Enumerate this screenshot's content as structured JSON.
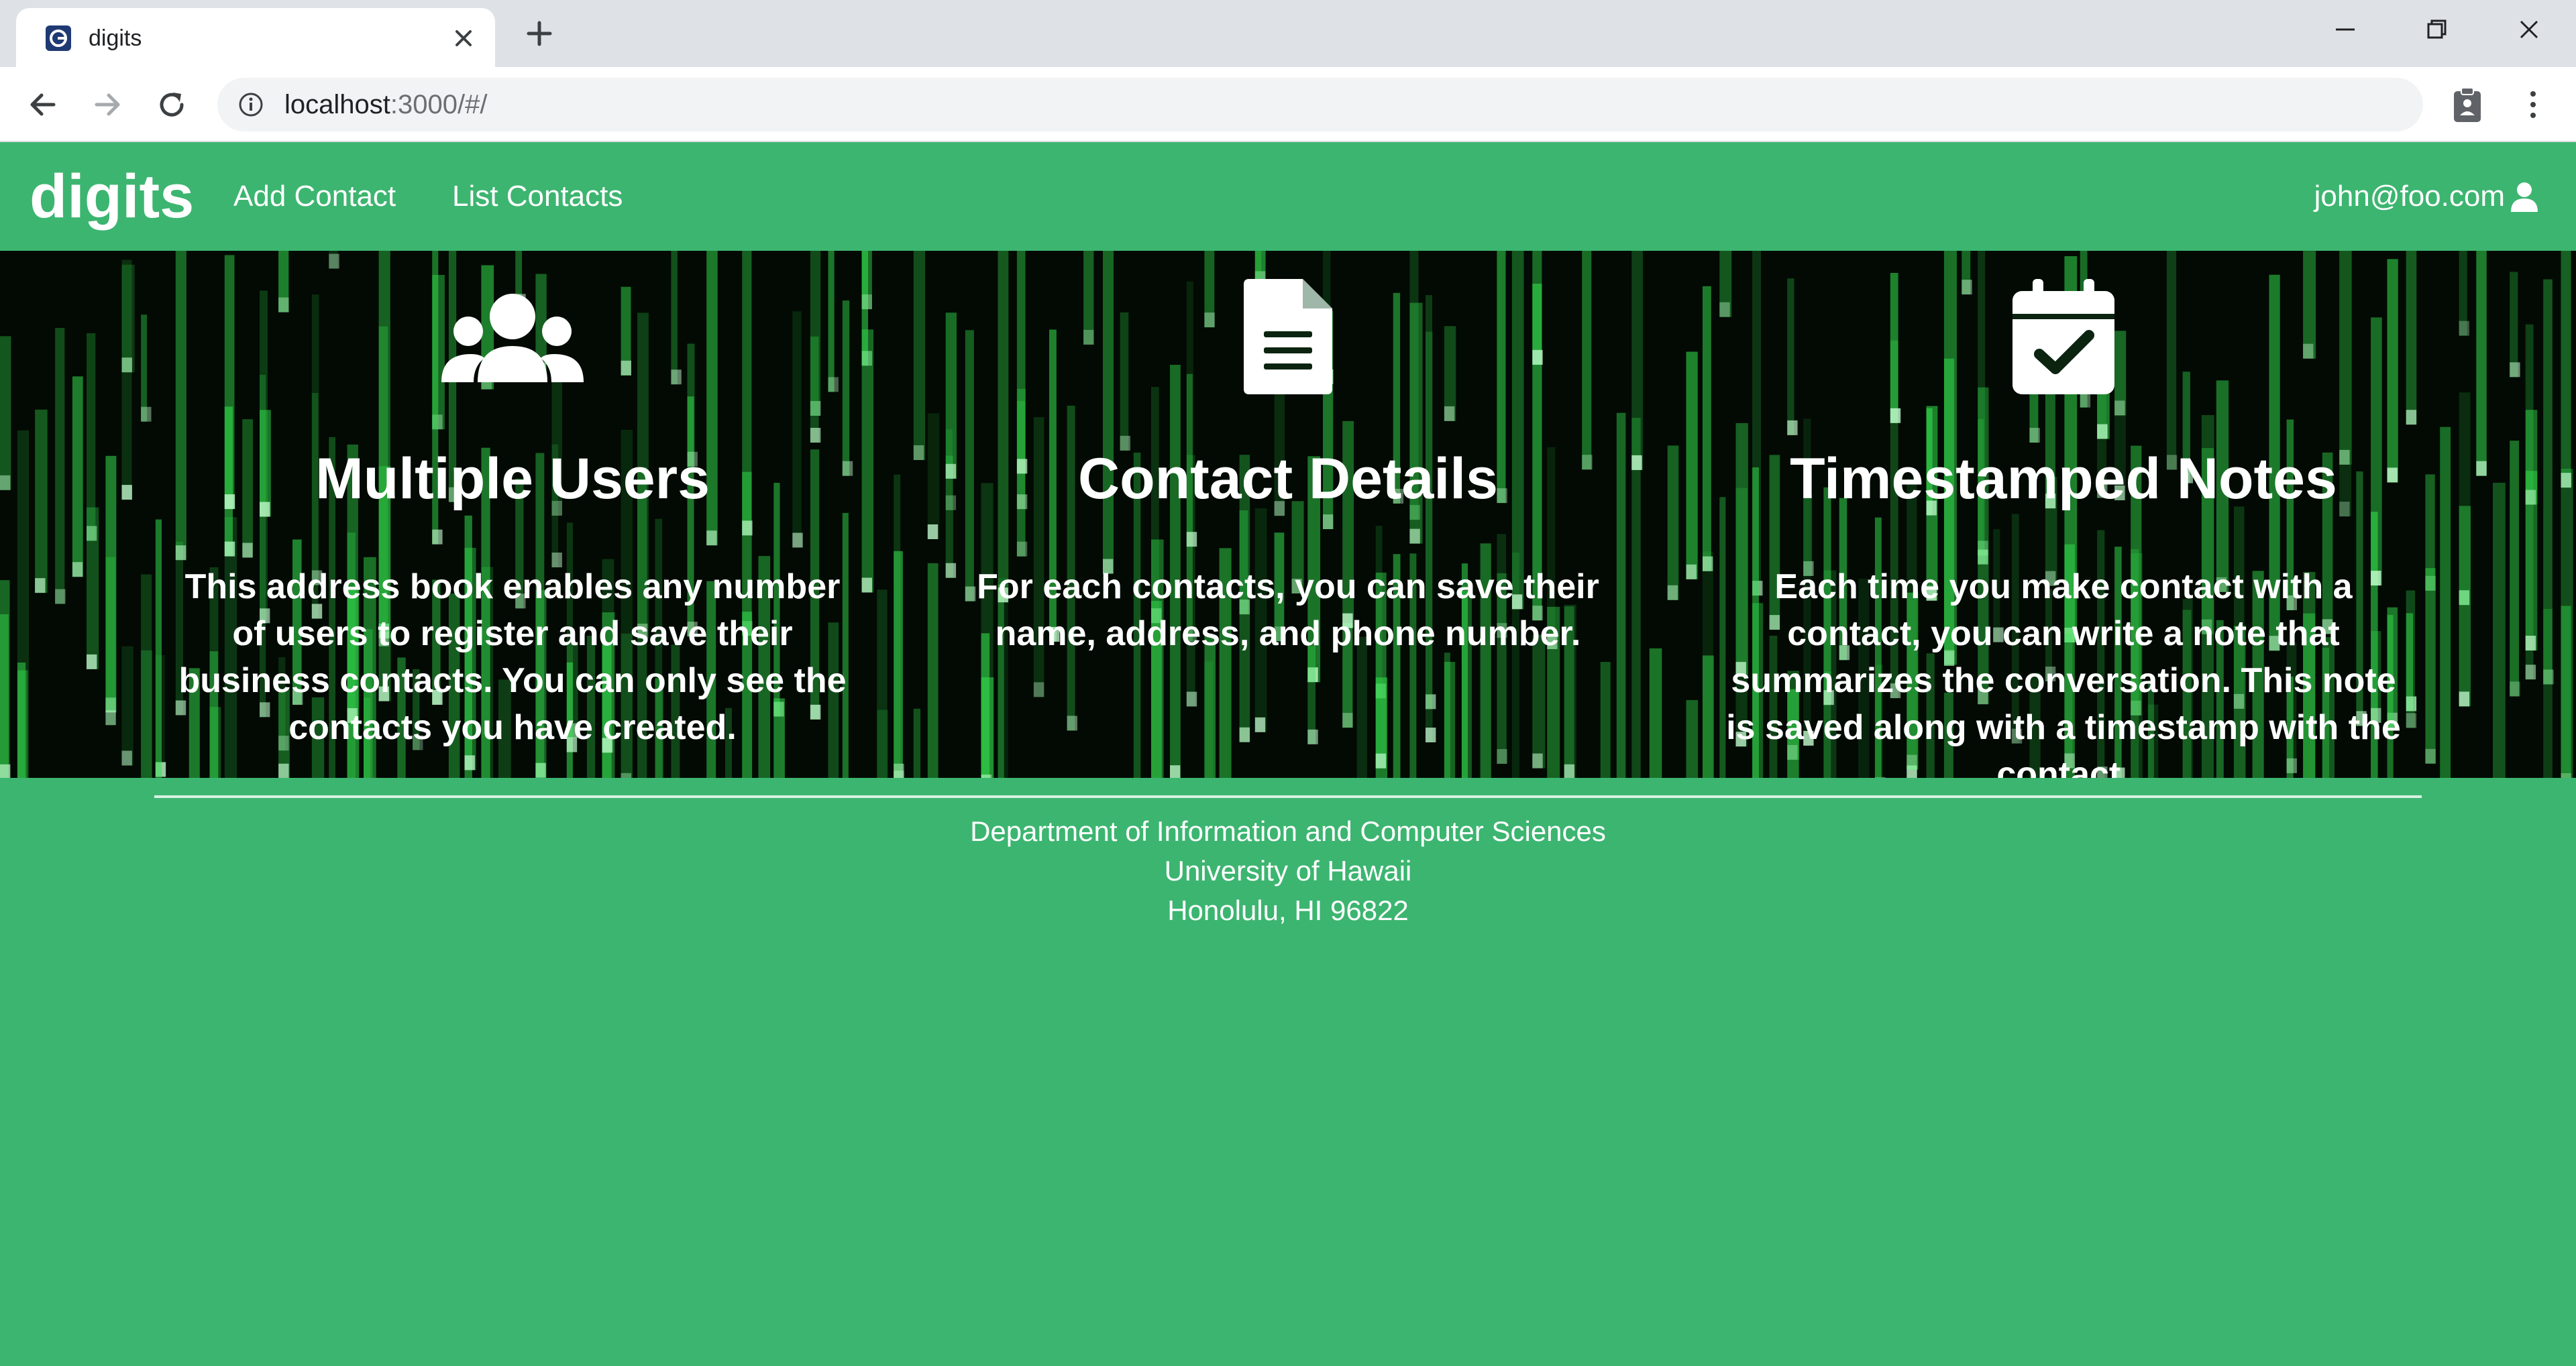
{
  "browser": {
    "tab_title": "digits",
    "url_host": "localhost",
    "url_rest": ":3000/#/"
  },
  "navbar": {
    "brand": "digits",
    "links": [
      "Add Contact",
      "List Contacts"
    ],
    "user_email": "john@foo.com"
  },
  "features": [
    {
      "icon": "users-icon",
      "title": "Multiple Users",
      "text": "This address book enables any number of users to register and save their business contacts. You can only see the contacts you have created."
    },
    {
      "icon": "file-alt-icon",
      "title": "Contact Details",
      "text": "For each contacts, you can save their name, address, and phone number."
    },
    {
      "icon": "calendar-check-icon",
      "title": "Timestamped Notes",
      "text": "Each time you make contact with a contact, you can write a note that summarizes the conversation. This note is saved along with a timestamp with the contact."
    }
  ],
  "footer": {
    "lines": [
      "Department of Information and Computer Sciences",
      "University of Hawaii",
      "Honolulu, HI 96822"
    ]
  },
  "colors": {
    "brand_green": "#3cb570",
    "hero_dark": "#020a03",
    "matrix_green": "#35e04f",
    "chrome_gray": "#dee1e6"
  }
}
